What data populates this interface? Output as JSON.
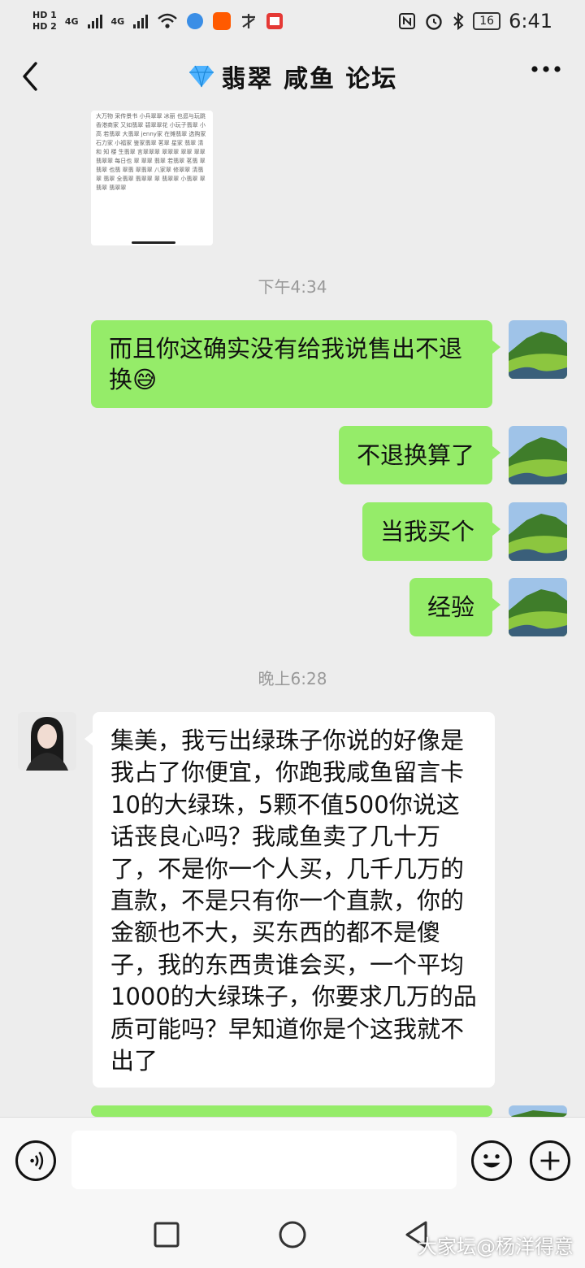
{
  "status_bar": {
    "hd1": "HD 1",
    "hd2": "HD 2",
    "signal1": "4G",
    "signal2": "4G",
    "battery": "16",
    "time": "6:41"
  },
  "nav": {
    "title_name": "翡翠 咸鱼  论坛",
    "back_icon": "chevron-left-icon",
    "more_icon": "more-icon"
  },
  "preview_image": {
    "lines": "大万物 采传景书 小兵翠翠 冰丽 也逛与玩跳 香港商家 又如翡翠 碧翠翠花 小玩子翡翠 小高 若翡翠 大翡翠 jenny家 在摊翡翠 选购家 石力家 小福家 鉴家翡翠 茗翠 星家 翡翠 清 和 知 楼 生翡翠 言翠翠翠 翠翠翠 翠翠 翠翠 翡翠翠 每日也 翠 翠翠 翡翠 若翡翠 茗翡 翠 翡翠 也翡 翠翡 翠翡翠 八家翠 修翠翠 清翡翠 翡翠 全翡翠 翡翠翠 翠 翡翠翠 小翡翠 翠翡翠 翡翠翠"
  },
  "messages": {
    "time1": "下午4:34",
    "m1": "而且你这确实没有给我说售出不退换😅",
    "m2": "不退换算了",
    "m3": "当我买个",
    "m4": "经验",
    "time2": "晚上6:28",
    "m5": "集美，我亏出绿珠子你说的好像是我占了你便宜，你跑我咸鱼留言卡10的大绿珠，5颗不值500你说这话丧良心吗？我咸鱼卖了几十万了，不是你一个人买，几千几万的直款，不是只有你一个直款，你的金额也不大，买东西的都不是傻子，我的东西贵谁会买，一个平均1000的大绿珠子，你要求几万的品质可能吗？早知道你是个这我就不出了"
  },
  "input_bar": {
    "voice_icon": "voice-icon",
    "emoji_icon": "emoji-icon",
    "add_icon": "plus-icon"
  },
  "watermark": "大家坛@杨洋得意",
  "colors": {
    "background": "#ededed",
    "sent_bubble": "#95ec69",
    "received_bubble": "#ffffff",
    "timestamp": "#999999"
  }
}
